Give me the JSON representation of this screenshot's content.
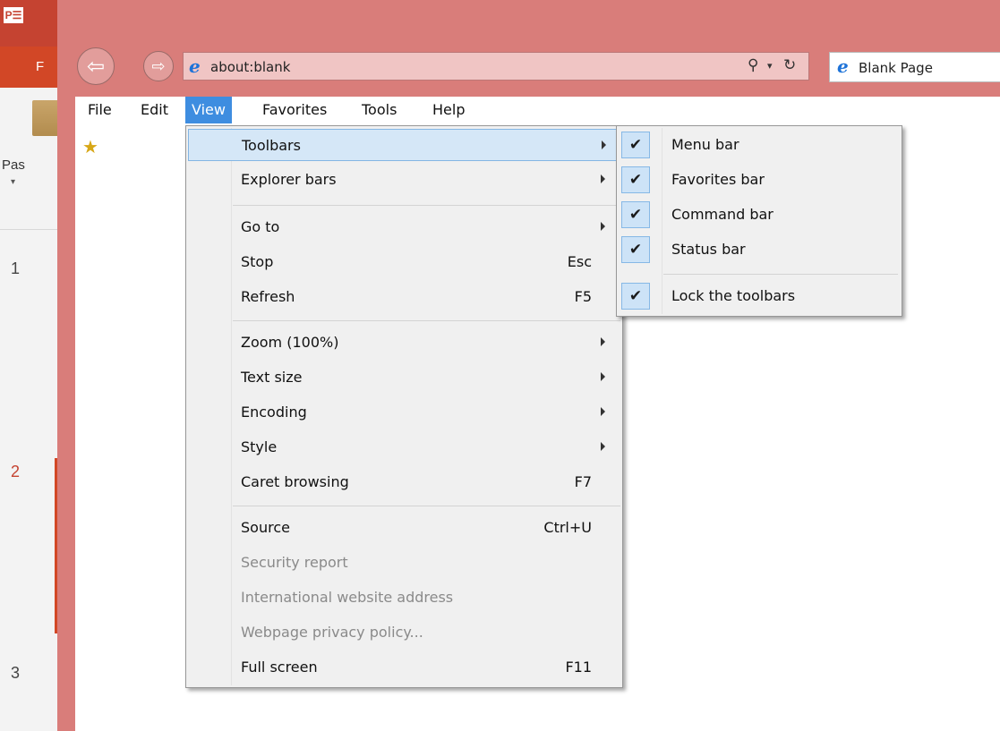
{
  "powerpoint": {
    "logo": "P☰",
    "ribbon_tab_letter": "F",
    "paste_label": "Pas",
    "slide_numbers": [
      "1",
      "2",
      "3"
    ]
  },
  "browser": {
    "address": "about:blank",
    "tab_title": "Blank Page"
  },
  "menubar": [
    "File",
    "Edit",
    "View",
    "Favorites",
    "Tools",
    "Help"
  ],
  "view_menu": [
    {
      "label": "Toolbars",
      "arrow": true
    },
    {
      "label": "Explorer bars",
      "arrow": true
    },
    {
      "label": "Go to",
      "arrow": true
    },
    {
      "label": "Stop",
      "shortcut": "Esc"
    },
    {
      "label": "Refresh",
      "shortcut": "F5"
    },
    {
      "label": "Zoom (100%)",
      "arrow": true
    },
    {
      "label": "Text size",
      "arrow": true
    },
    {
      "label": "Encoding",
      "arrow": true
    },
    {
      "label": "Style",
      "arrow": true
    },
    {
      "label": "Caret browsing",
      "shortcut": "F7"
    },
    {
      "label": "Source",
      "shortcut": "Ctrl+U"
    },
    {
      "label": "Security report",
      "disabled": true
    },
    {
      "label": "International website address",
      "disabled": true
    },
    {
      "label": "Webpage privacy policy...",
      "disabled": true
    },
    {
      "label": "Full screen",
      "shortcut": "F11"
    }
  ],
  "toolbars_submenu": [
    {
      "label": "Menu bar",
      "checked": true
    },
    {
      "label": "Favorites bar",
      "checked": true
    },
    {
      "label": "Command bar",
      "checked": true
    },
    {
      "label": "Status bar",
      "checked": true
    },
    {
      "label": "Lock the toolbars",
      "checked": true
    }
  ],
  "colors": {
    "ie_frame": "#d97d7a",
    "menu_highlight": "#d5e7f7",
    "menubar_active": "#3e8de0",
    "ppt_accent": "#d24726"
  }
}
